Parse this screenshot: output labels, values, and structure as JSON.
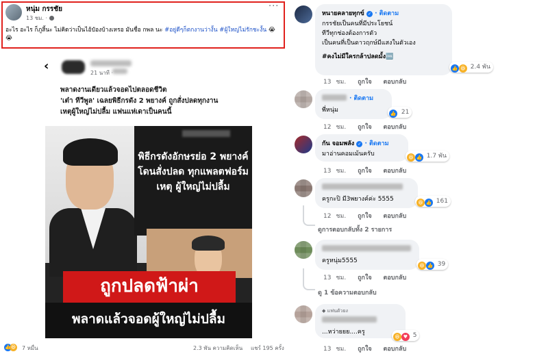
{
  "post": {
    "author": "หนุ่ม กรรชัย",
    "time": "13 ชม. ·",
    "more": "···",
    "text": "อะไร อะไร ก็ภูสิ้นะ ไม่คิดว่าเป็นไอ้ป๋องบ้างเหรอ มันชื่อ กพล นะ",
    "hashtags": "#อยู่ดีๆก็ตกงานว่างั้น #ผู้ใหญ่ไม่รักชะงั้น",
    "emoji": "😭😭"
  },
  "shared": {
    "time": "21 นาที ·",
    "line1": "พลาดงานเดียวแล้วจอดไปตลอดชีวิต",
    "line2": "'เต๋า ทีวีพูล' เฉลยพิธีกรดัง 2 พยางค์ ถูกสั่งปลดทุกงาน",
    "line3": "เหตุผู้ใหญ่ไม่ปลื้ม แฟนแห่เดาเป็นคนนี้",
    "image_headline": "พิธีกรดังอักษรย่อ 2 พยางค์โดนสั่งปลด ทุกแพลตฟอร์มเหตุ ผู้ใหญ่ไม่ปลื้ม",
    "image_band": "ถูกปลดฟ้าผ่า",
    "image_bottom": "พลาดแล้วจอดผู้ใหญ่ไม่ปลื้ม"
  },
  "footer": {
    "reactions": "7 หมื่น",
    "comments": "2.3 พัน ความคิดเห็น",
    "shares": "แชร์ 195 ครั้ง"
  },
  "comments": [
    {
      "name": "หนายคลายทุกข์",
      "follow": "· ติดตาม",
      "lines": [
        "กรรชัยเป็นคนที่มีประโยชน์",
        "ทีวีทุกช่องต้องการตัว",
        "เป็นคนที่เป็นดาวฤกษ์มีแสงในตัวเอง",
        "#คงไม่มีใครกล้าปลดมั้ง🆒"
      ],
      "reactions": "2.4 พัน",
      "time": "13 ชม.",
      "like": "ถูกใจ",
      "reply": "ตอบกลับ"
    },
    {
      "follow": "· ติดตาม",
      "lines": [
        "พี่หนุ่ม"
      ],
      "reactions": "21",
      "time": "12 ชม.",
      "like": "ถูกใจ",
      "reply": "ตอบกลับ"
    },
    {
      "name": "กัน จอมพลัง",
      "follow": "· ติดตาม",
      "lines": [
        "มาอ่านคอมเม้นครับ"
      ],
      "reactions": "1.7 พัน",
      "time": "13 ชม.",
      "like": "ถูกใจ",
      "reply": "ตอบกลับ"
    },
    {
      "lines": [
        "ครูกะปิ มี3พยางค์ค่ะ 5555"
      ],
      "reactions": "161",
      "time": "12 ชม.",
      "like": "ถูกใจ",
      "reply": "ตอบกลับ",
      "view_replies": "ดูการตอบกลับทั้ง 2 รายการ"
    },
    {
      "lines": [
        "ครูหนุ่ม5555"
      ],
      "reactions": "39",
      "time": "13 ชม.",
      "like": "ถูกใจ",
      "reply": "ตอบกลับ",
      "view_replies": "ดู 1 ข้อความตอบกลับ"
    },
    {
      "badge": "แฟนตัวยง",
      "lines": [
        "...หว่ายยย....ครู"
      ],
      "reactions": "5",
      "time": "13 ชม.",
      "like": "ถูกใจ",
      "reply": "ตอบกลับ"
    }
  ],
  "colors": {
    "highlight_border": "#e0201c",
    "link_blue": "#1877f2",
    "band_red": "#d01818",
    "bubble": "#f0f2f5"
  }
}
